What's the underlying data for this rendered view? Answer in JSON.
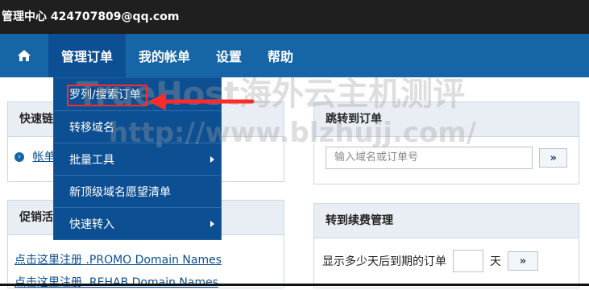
{
  "header": {
    "title": "管理中心 424707809@qq.com"
  },
  "nav": {
    "home_icon": "home-icon",
    "items": [
      {
        "label": "管理订单"
      },
      {
        "label": "我的帐单"
      },
      {
        "label": "设置"
      },
      {
        "label": "帮助"
      }
    ]
  },
  "dropdown": {
    "items": [
      {
        "label": "罗列/搜索订单"
      },
      {
        "label": "转移域名"
      },
      {
        "label": "批量工具"
      },
      {
        "label": "新顶级域名愿望清单"
      },
      {
        "label": "快速转入"
      }
    ]
  },
  "left": {
    "quick_title": "快速链",
    "quick_link": "帐单",
    "promo_title": "促销活",
    "promo_links": [
      "点击这里注册 .PROMO Domain Names",
      "点击这里注册 .REHAB Domain Names"
    ]
  },
  "right": {
    "jump_title": "跳转到订单",
    "jump_placeholder": "输入域名或订单号",
    "go_label": "»",
    "renew_title": "转到续费管理",
    "renew_label": "显示多少天后到期的订单",
    "renew_unit": "天",
    "renew_go_label": "»"
  },
  "watermark": {
    "line1": "TrueHost海外云主机测评",
    "line2": "http://www.blzhujj.com/"
  },
  "colors": {
    "nav": "#1565a7",
    "nav_active": "#0d4f93",
    "top": "#1f1f1f",
    "accent_red": "#ff2b2b"
  }
}
